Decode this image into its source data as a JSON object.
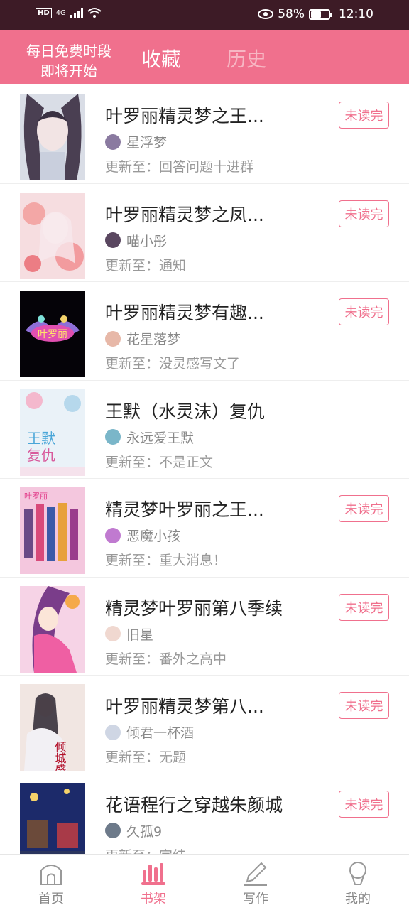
{
  "status_bar": {
    "network": "4G",
    "battery_percent": "58%",
    "time": "12:10",
    "battery_level": 0.58
  },
  "header": {
    "free_time_line1": "每日免费时段",
    "free_time_line2": "即将开始",
    "tab_favorites": "收藏",
    "tab_history": "历史"
  },
  "colors": {
    "accent": "#f0708d",
    "statusbar": "#3d1b26"
  },
  "books": [
    {
      "title": "叶罗丽精灵梦之王...",
      "author": "星浮梦",
      "update": "更新至：回答问题十进群",
      "badge": "未读完"
    },
    {
      "title": "叶罗丽精灵梦之凤...",
      "author": "喵小彤",
      "update": "更新至：通知",
      "badge": "未读完"
    },
    {
      "title": "叶罗丽精灵梦有趣...",
      "author": "花星落梦",
      "update": "更新至：没灵感写文了",
      "badge": "未读完"
    },
    {
      "title": "王默（水灵沫）复仇",
      "author": "永远爱王默",
      "update": "更新至：不是正文",
      "badge": ""
    },
    {
      "title": "精灵梦叶罗丽之王...",
      "author": "恶魔小孩",
      "update": "更新至：重大消息！",
      "badge": "未读完"
    },
    {
      "title": "精灵梦叶罗丽第八季续",
      "author": "旧星",
      "update": "更新至：番外之高中",
      "badge": "未读完"
    },
    {
      "title": "叶罗丽精灵梦第八...",
      "author": "倾君一杯酒",
      "update": "更新至：无题",
      "badge": "未读完"
    },
    {
      "title": "花语程行之穿越朱颜城",
      "author": "久孤9",
      "update": "更新至：完结",
      "badge": "未读完"
    }
  ],
  "covers": {
    "cover_3_text": "叶罗丽",
    "cover_4_text_a": "王默",
    "cover_4_text_b": "复仇",
    "cover_7_text": "倾城盛世"
  },
  "nav": {
    "home": "首页",
    "shelf": "书架",
    "write": "写作",
    "mine": "我的"
  }
}
